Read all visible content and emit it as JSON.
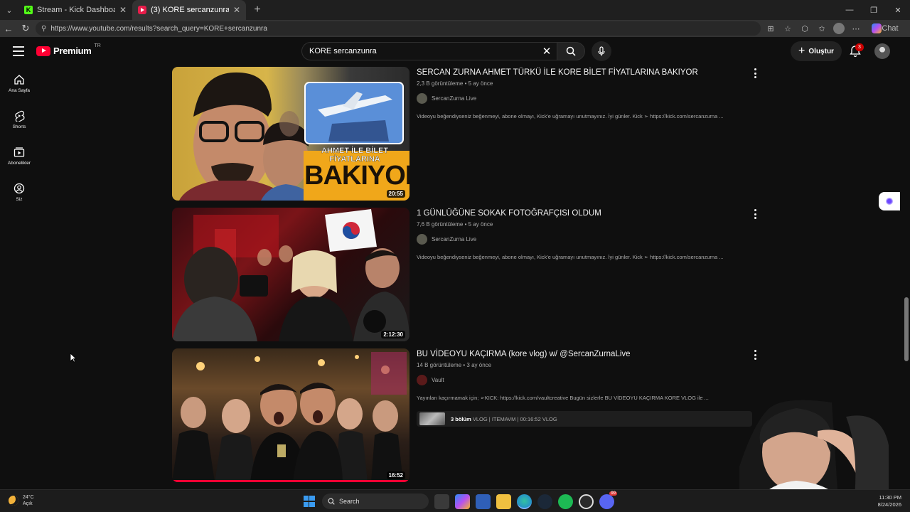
{
  "browser": {
    "tabs": [
      {
        "title": "Stream - Kick Dashboard",
        "icon": "kick-icon",
        "fav": "K"
      },
      {
        "title": "(3) KORE sercanzunra - YouTube",
        "icon": "youtube-icon"
      }
    ],
    "close_glyph": "✕",
    "new_tab_glyph": "+",
    "url": "https://www.youtube.com/results?search_query=KORE+sercanzunra",
    "chat_label": "Chat"
  },
  "youtube": {
    "logo_text": "Premium",
    "country": "TR",
    "search": {
      "query": "KORE sercanzunra"
    },
    "create_label": "Oluştur",
    "notification_count": "3",
    "sidebar": [
      {
        "label": "Ana Sayfa",
        "icon": "home-icon"
      },
      {
        "label": "Shorts",
        "icon": "shorts-icon"
      },
      {
        "label": "Abonelikler",
        "icon": "subscriptions-icon"
      },
      {
        "label": "Siz",
        "icon": "you-icon"
      }
    ],
    "results": [
      {
        "title": "SERCAN ZURNA AHMET TÜRKÜ İLE KORE BİLET FİYATLARINA BAKIYOR",
        "views": "2,3 B görüntüleme",
        "age": "5 ay önce",
        "channel": "SercanZurna Live",
        "description": "Videoyu beğendiyseniz beğenmeyi, abone olmayı, Kick'e uğramayı unutmayınız. İyi günler. Kick ➢ https://kick.com/sercanzurna ...",
        "duration": "20:55",
        "thumb_text_1": "AHMET İLE BİLET FİYATLARINA",
        "thumb_text_2": "BAKIYOR"
      },
      {
        "title": "1 GÜNLÜĞÜNE SOKAK FOTOĞRAFÇISI OLDUM",
        "views": "7,6 B görüntüleme",
        "age": "5 ay önce",
        "channel": "SercanZurna Live",
        "description": "Videoyu beğendiyseniz beğenmeyi, abone olmayı, Kick'e uğramayı unutmayınız. İyi günler. Kick ➢ https://kick.com/sercanzurna ...",
        "duration": "2:12:30"
      },
      {
        "title": "BU VİDEOYU KAÇIRMA (kore vlog) w/ @SercanZurnaLive",
        "views": "14 B görüntüleme",
        "age": "3 ay önce",
        "channel": "Vault",
        "description": "Yayınları kaçırmamak için; ➢KICK: https://kick.com/vaultcreative Bugün sizlerle BU VİDEOYU KAÇIRMA KORE VLOG ile ...",
        "duration": "16:52",
        "watched_fraction": 1.0,
        "chapters_count": "3 bölüm",
        "chapters_text": "VLOG | ITEMAVM | 00:16:52 VLOG"
      }
    ]
  },
  "taskbar": {
    "temperature": "24°C",
    "weather": "Açık",
    "search_placeholder": "Search",
    "time": "11:30 PM",
    "date": "8/24/2026",
    "discord_badge": "99"
  }
}
